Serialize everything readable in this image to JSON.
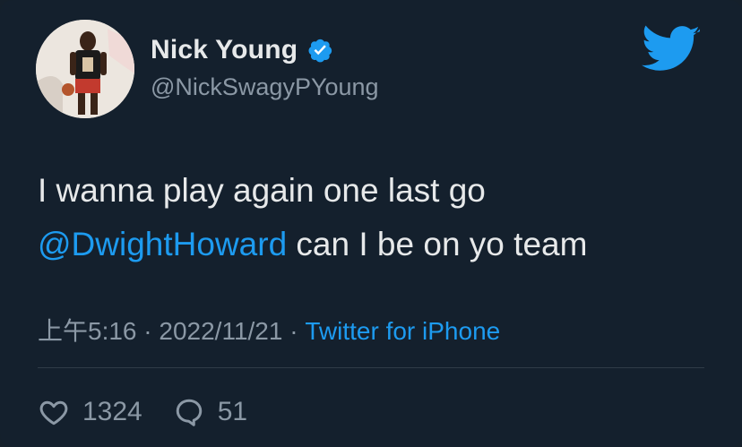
{
  "author": {
    "display_name": "Nick Young",
    "handle": "@NickSwagyPYoung",
    "verified_icon": "verified-badge-icon"
  },
  "brand_icon": "twitter-bird-icon",
  "tweet": {
    "line1": "I wanna play again one last go",
    "mention": "@DwightHoward",
    "line2_rest": " can I be on yo team"
  },
  "meta": {
    "time": "上午5:16",
    "separator1": " · ",
    "date": "2022/11/21",
    "separator2": " · ",
    "source": "Twitter for iPhone"
  },
  "stats": {
    "likes": "1324",
    "replies": "51"
  },
  "colors": {
    "background": "#14202d",
    "accent": "#1d9bf0",
    "text": "#e7e9ea",
    "muted": "#8b98a5"
  }
}
